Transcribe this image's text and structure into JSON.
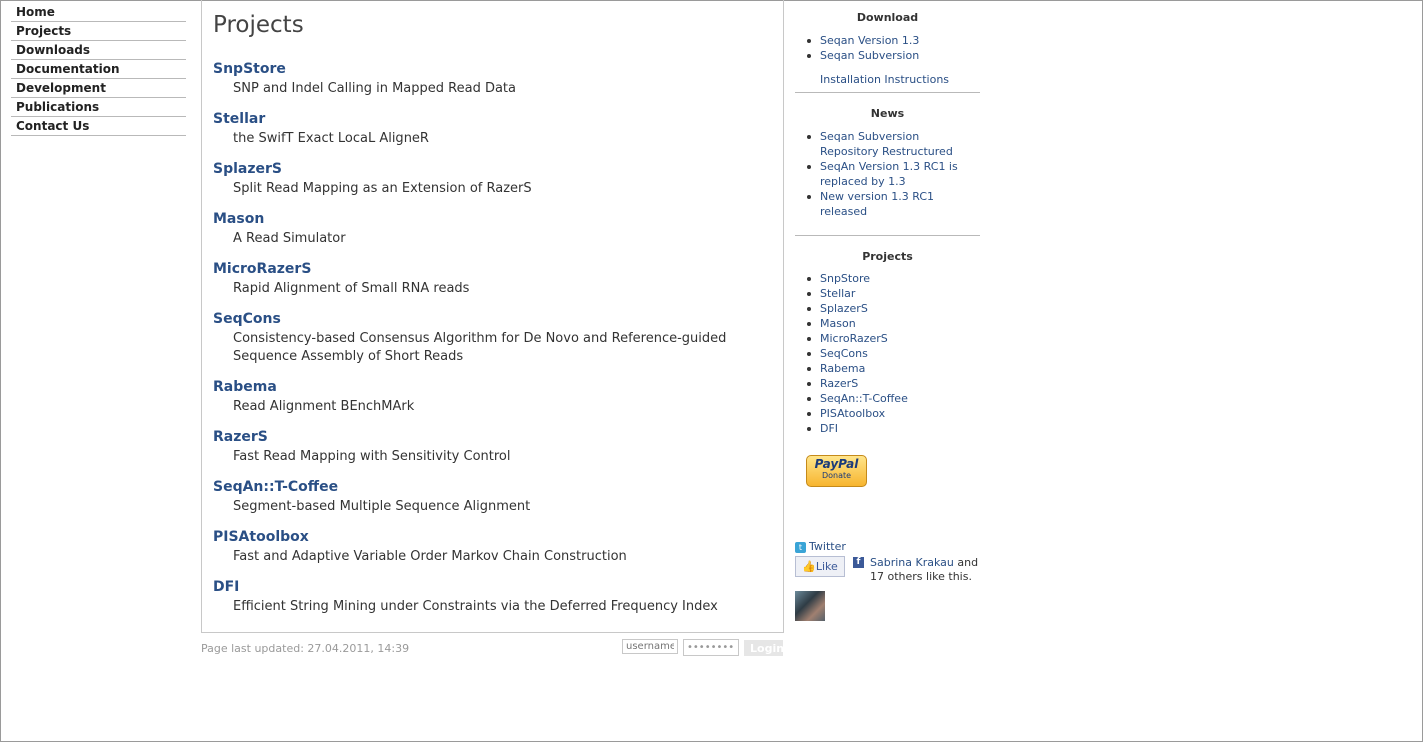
{
  "nav": [
    {
      "label": "Home"
    },
    {
      "label": "Projects"
    },
    {
      "label": "Downloads"
    },
    {
      "label": "Documentation"
    },
    {
      "label": "Development"
    },
    {
      "label": "Publications"
    },
    {
      "label": "Contact Us"
    }
  ],
  "main": {
    "title": "Projects",
    "projects": [
      {
        "name": "SnpStore",
        "desc": "SNP and Indel Calling in Mapped Read Data"
      },
      {
        "name": "Stellar",
        "desc": "the SwifT Exact LocaL AligneR"
      },
      {
        "name": "SplazerS",
        "desc": "Split Read Mapping as an Extension of RazerS"
      },
      {
        "name": "Mason",
        "desc": "A Read Simulator"
      },
      {
        "name": "MicroRazerS",
        "desc": "Rapid Alignment of Small RNA reads"
      },
      {
        "name": "SeqCons",
        "desc": "Consistency-based Consensus Algorithm for De Novo and Reference-guided Sequence Assembly of Short Reads"
      },
      {
        "name": "Rabema",
        "desc": "Read Alignment BEnchMArk"
      },
      {
        "name": "RazerS",
        "desc": "Fast Read Mapping with Sensitivity Control"
      },
      {
        "name": "SeqAn::T-Coffee",
        "desc": "Segment-based Multiple Sequence Alignment"
      },
      {
        "name": "PISAtoolbox",
        "desc": "Fast and Adaptive Variable Order Markov Chain Construction"
      },
      {
        "name": "DFI",
        "desc": "Efficient String Mining under Constraints via the Deferred Frequency Index"
      }
    ]
  },
  "footer": {
    "updated": "Page last updated: 27.04.2011, 14:39",
    "username_placeholder": "username",
    "password_value": "••••••••",
    "login_label": "Login"
  },
  "sidebar": {
    "download": {
      "title": "Download",
      "links": [
        "Seqan Version 1.3",
        "Seqan Subversion"
      ],
      "install": "Installation Instructions"
    },
    "news": {
      "title": "News",
      "items": [
        "Seqan Subversion Repository Restructured",
        "SeqAn Version 1.3 RC1 is replaced by 1.3",
        "New version 1.3 RC1 released"
      ]
    },
    "projects": {
      "title": "Projects",
      "items": [
        "SnpStore",
        "Stellar",
        "SplazerS",
        "Mason",
        "MicroRazerS",
        "SeqCons",
        "Rabema",
        "RazerS",
        "SeqAn::T-Coffee",
        "PISAtoolbox",
        "DFI"
      ]
    },
    "paypal": {
      "logo": "PayPal",
      "sub": "Donate"
    },
    "twitter": "Twitter",
    "facebook": {
      "like": "Like",
      "person": "Sabrina Krakau",
      "rest_1": " and",
      "rest_2": "17 others like this."
    }
  }
}
